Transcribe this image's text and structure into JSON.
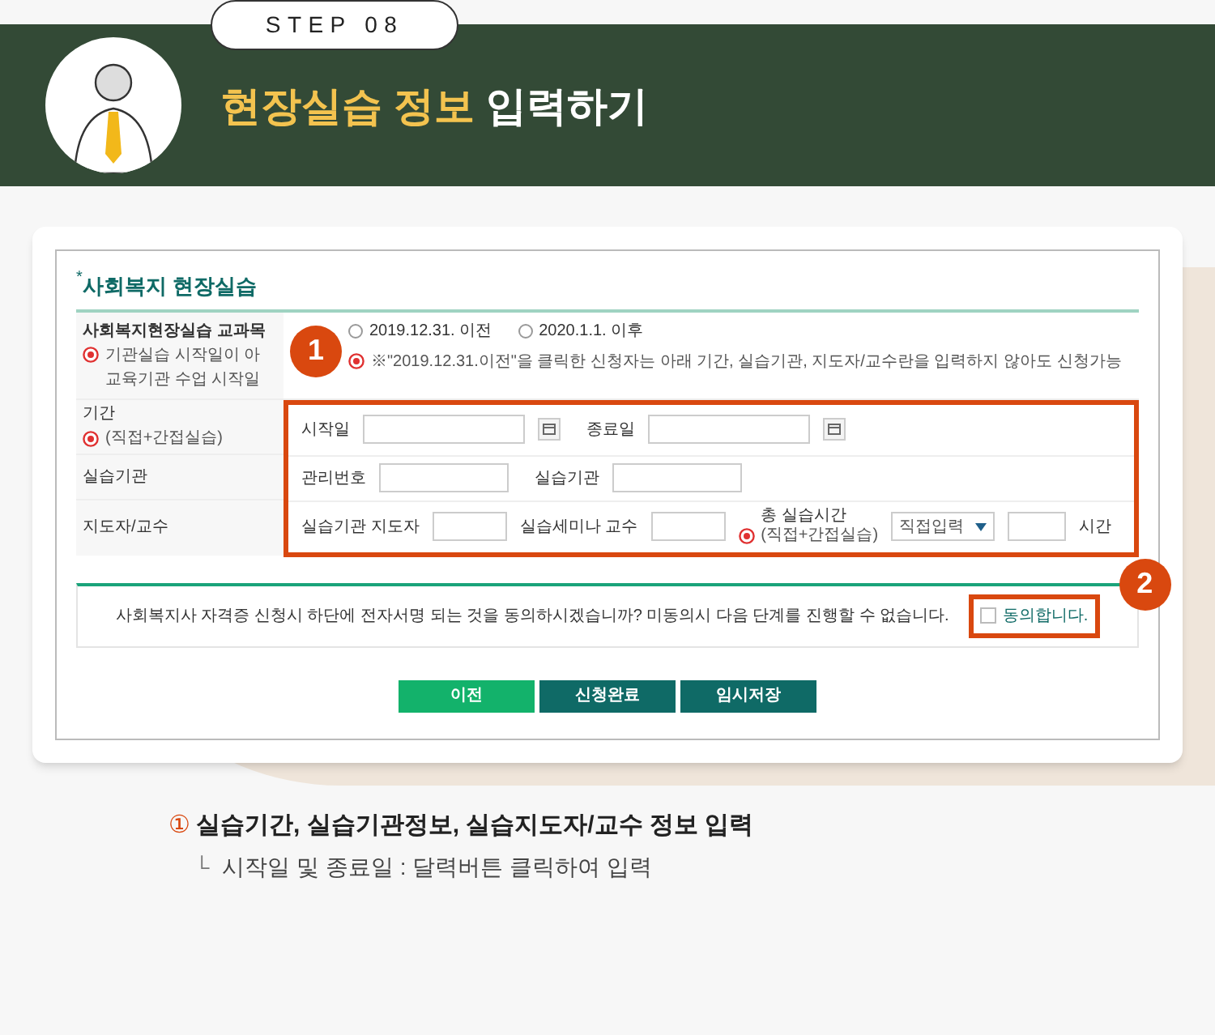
{
  "header": {
    "step": "STEP 08",
    "title_highlight": "현장실습 정보",
    "title_rest": "입력하기"
  },
  "form": {
    "required_mark": "*",
    "title": "사회복지 현장실습",
    "course_row": {
      "label": "사회복지현장실습 교과목",
      "notes": [
        "기관실습 시작일이 아",
        "교육기관 수업 시작일"
      ],
      "options": [
        {
          "label": "2019.12.31. 이전",
          "selected": false
        },
        {
          "label": "2020.1.1. 이후",
          "selected": false
        }
      ],
      "note": "※\"2019.12.31.이전\"을 클릭한 신청자는 아래 기간, 실습기관, 지도자/교수란을 입력하지 않아도 신청가능"
    },
    "period_row": {
      "label": "기간",
      "sublabel": "(직접+간접실습)",
      "fields": [
        "시작일",
        "종료일"
      ]
    },
    "institution_row": {
      "label": "실습기관",
      "fields": [
        "관리번호",
        "실습기관"
      ]
    },
    "supervisor_row": {
      "label": "지도자/교수",
      "fields": [
        "실습기관 지도자",
        "실습세미나 교수"
      ],
      "hours_label": "총 실습시간",
      "hours_sublabel": "(직접+간접실습)",
      "select_value": "직접입력",
      "unit": "시간"
    },
    "agreement": {
      "text": "사회복지사 자격증 신청시 하단에 전자서명 되는 것을 동의하시겠습니까? 미동의시 다음 단계를 진행할 수 없습니다.",
      "checkbox_label": "동의합니다.",
      "checked": false
    },
    "buttons": [
      {
        "label": "이전",
        "kind": "light"
      },
      {
        "label": "신청완료",
        "kind": "dark"
      },
      {
        "label": "임시저장",
        "kind": "dark"
      }
    ]
  },
  "callouts": [
    "1",
    "2"
  ],
  "instructions": {
    "number": "①",
    "heading": "실습기간, 실습기관정보, 실습지도자/교수 정보 입력",
    "sub_mark": "└",
    "sub_text": "시작일 및 종료일 : 달력버튼 클릭하여 입력"
  }
}
